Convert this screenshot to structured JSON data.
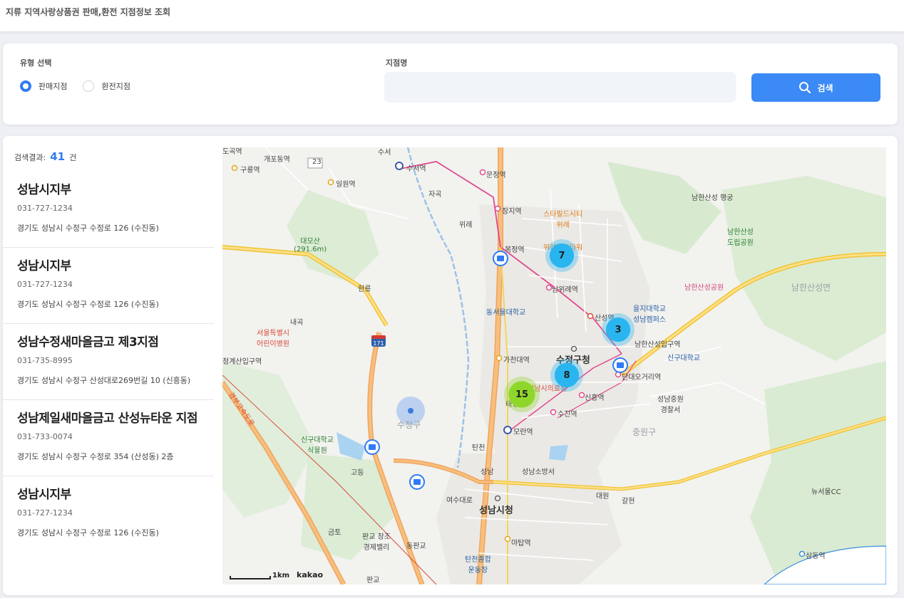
{
  "header": {
    "title": "지류 지역사랑상품권 판매,환전 지점정보 조회"
  },
  "search": {
    "type_label": "유형 선택",
    "options": [
      {
        "label": "판매지점",
        "selected": true
      },
      {
        "label": "환전지점",
        "selected": false
      }
    ],
    "branch_label": "지점명",
    "branch_value": "",
    "button_label": "검색"
  },
  "results": {
    "count_label": "검색결과:",
    "count": "41",
    "count_unit": "건",
    "items": [
      {
        "name": "성남시지부",
        "phone": "031-727-1234",
        "address": "경기도 성남시 수정구 수정로 126 (수진동)"
      },
      {
        "name": "성남시지부",
        "phone": "031-727-1234",
        "address": "경기도 성남시 수정구 수정로 126 (수진동)"
      },
      {
        "name": "성남수정새마을금고 제3지점",
        "phone": "031-735-8995",
        "address": "경기도 성남시 수정구 산성대로269번길 10 (신흥동)"
      },
      {
        "name": "성남제일새마을금고 산성뉴타운 지점",
        "phone": "031-733-0074",
        "address": "경기도 성남시 수정구 수정로 354 (산성동) 2층"
      },
      {
        "name": "성남시지부",
        "phone": "031-727-1234",
        "address": "경기도 성남시 수정구 수정로 126 (수진동)"
      }
    ]
  },
  "map": {
    "clusters": [
      {
        "count": "7",
        "color": "#29b5f0"
      },
      {
        "count": "3",
        "color": "#29b5f0"
      },
      {
        "count": "8",
        "color": "#29b5f0"
      },
      {
        "count": "15",
        "color": "#8fd62a"
      }
    ],
    "labels": {
      "dokok": "도곡역",
      "gaepo": "개포동역",
      "guryong": "구룡역",
      "suseo": "수서역",
      "munjeong": "문정역",
      "irwon": "일원역",
      "jamsil": "장지역",
      "bokjeong": "복정역",
      "wirye": "스타필드시티\n위례",
      "wirye_tower": "위례중앙타워",
      "namwirye": "남위례역",
      "daemosan": "대모산\n(291.6m)",
      "heolleung": "헌릉",
      "naegok": "내곡",
      "seoul_hospital": "서울특별시\n어린이병원",
      "dongseoul": "동서울대학교",
      "sanseong": "산성역",
      "eulji": "을지대학교\n성남캠퍼스",
      "namhansanseong_haenggung": "남한산성 행궁",
      "namhansanseong_park": "남한산성\n도립공원",
      "namhansanseong_park2": "남한산성공원",
      "namhansanseong_myeon": "남한산성면",
      "namhansanseong_station": "남한산성입구역",
      "sinhan": "신구대학교",
      "danda": "단대오거리역",
      "sujeong_office": "수정구청",
      "gacheon": "가천대역",
      "seongnam_medical": "성남시의료원",
      "sinheung": "신흥역",
      "taepyeong": "태평역",
      "sujin": "수진역",
      "moran": "모란역",
      "sujeong_gu": "수정구",
      "jungwon_gu": "중원구",
      "jungwon_police": "성남중원\n경찰서",
      "gyeongsan": "청계산입구역",
      "singu_garden": "신구대학교\n식물원",
      "godeung": "고등",
      "tancheon": "탄천",
      "seongnam": "성남",
      "fire": "성남소방서",
      "yeosu": "여수대로",
      "city_hall": "성남시청",
      "pangyo_valley": "판교 창조\n경제밸리",
      "dongpangyo": "동판교",
      "tancheon_sports": "탄천종합\n운동장",
      "yatap": "야탑역",
      "daewon": "대원",
      "galhyeon": "갈현",
      "neusurol": "뉴서울CC",
      "sampyeong": "삼동역",
      "geumto": "금토",
      "pangyo": "판교",
      "suseo_ic": "수서",
      "jahaek": "자곡",
      "wirye_ic": "위례",
      "expressway": "경부고속도로",
      "route": "23"
    },
    "scale_label": "1km",
    "provider": "kakao"
  }
}
